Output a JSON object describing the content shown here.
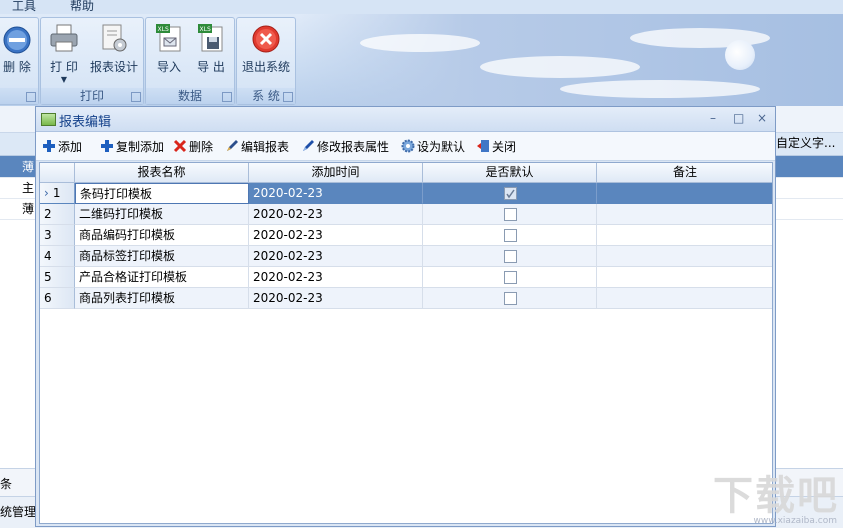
{
  "menubar": {
    "items": [
      "工具",
      "帮助"
    ]
  },
  "ribbon": {
    "groups": [
      {
        "label": "",
        "buttons": [
          {
            "label": "删 除",
            "icon": "minus-circle-icon"
          }
        ]
      },
      {
        "label": "打印",
        "buttons": [
          {
            "label": "打 印",
            "icon": "printer-icon"
          },
          {
            "label": "报表设计",
            "icon": "report-design-icon"
          }
        ]
      },
      {
        "label": "数据",
        "buttons": [
          {
            "label": "导入",
            "icon": "xls-import-icon"
          },
          {
            "label": "导 出",
            "icon": "xls-export-icon"
          }
        ]
      },
      {
        "label": "系 统",
        "buttons": [
          {
            "label": "退出系统",
            "icon": "exit-icon"
          }
        ]
      }
    ]
  },
  "background_app": {
    "right_header": "自定义字...",
    "rows": [
      "薄",
      "主",
      "薄"
    ],
    "status_left": "条",
    "status_bottom": "统管理"
  },
  "dialog": {
    "title": "报表编辑",
    "window_controls": [
      "–",
      "□",
      "×"
    ],
    "toolbar": [
      {
        "label": "添加",
        "icon": "plus-icon"
      },
      {
        "label": "复制添加",
        "icon": "copy-add-icon"
      },
      {
        "label": "删除",
        "icon": "delete-x-icon"
      },
      {
        "label": "编辑报表",
        "icon": "pen-icon"
      },
      {
        "label": "修改报表属性",
        "icon": "pen-blue-icon"
      },
      {
        "label": "设为默认",
        "icon": "gear-icon"
      },
      {
        "label": "关闭",
        "icon": "door-exit-icon"
      }
    ],
    "grid": {
      "columns": [
        "报表名称",
        "添加时间",
        "是否默认",
        "备注"
      ],
      "rows": [
        {
          "num": "1",
          "name": "条码打印模板",
          "time": "2020-02-23",
          "default": true,
          "note": ""
        },
        {
          "num": "2",
          "name": "二维码打印模板",
          "time": "2020-02-23",
          "default": false,
          "note": ""
        },
        {
          "num": "3",
          "name": "商品编码打印模板",
          "time": "2020-02-23",
          "default": false,
          "note": ""
        },
        {
          "num": "4",
          "name": "商品标签打印模板",
          "time": "2020-02-23",
          "default": false,
          "note": ""
        },
        {
          "num": "5",
          "name": "产品合格证打印模板",
          "time": "2020-02-23",
          "default": false,
          "note": ""
        },
        {
          "num": "6",
          "name": "商品列表打印模板",
          "time": "2020-02-23",
          "default": false,
          "note": ""
        }
      ],
      "selected_row": 1
    }
  },
  "watermark": {
    "text": "下载吧",
    "url": "www.xiazaiba.com"
  },
  "colors": {
    "accent": "#5a86be",
    "title_text": "#15428b",
    "exit_red": "#e03a2f"
  }
}
